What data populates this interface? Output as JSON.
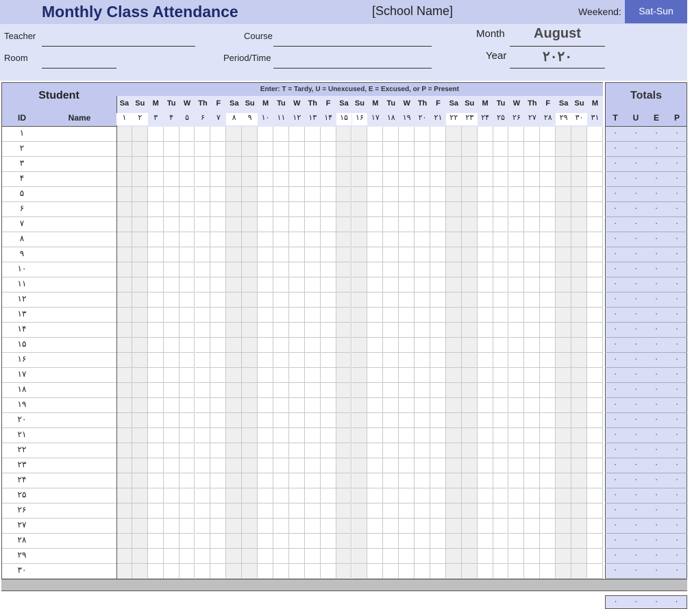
{
  "header": {
    "title": "Monthly Class Attendance",
    "school_name": "[School Name]",
    "weekend_label": "Weekend:",
    "weekend_value": "Sat-Sun"
  },
  "info": {
    "teacher_label": "Teacher",
    "room_label": "Room",
    "course_label": "Course",
    "period_label": "Period/Time",
    "month_label": "Month",
    "month_value": "August",
    "year_label": "Year",
    "year_value": "۲۰۲۰"
  },
  "table": {
    "student_header": "Student",
    "id_header": "ID",
    "name_header": "Name",
    "legend": "Enter: T = Tardy, U = Unexcused, E = Excused, or P = Present",
    "totals_header": "Totals",
    "totals_columns": [
      "T",
      "U",
      "E",
      "P"
    ],
    "day_names": [
      "Sa",
      "Su",
      "M",
      "Tu",
      "W",
      "Th",
      "F",
      "Sa",
      "Su",
      "M",
      "Tu",
      "W",
      "Th",
      "F",
      "Sa",
      "Su",
      "M",
      "Tu",
      "W",
      "Th",
      "F",
      "Sa",
      "Su",
      "M",
      "Tu",
      "W",
      "Th",
      "F",
      "Sa",
      "Su",
      "M"
    ],
    "day_numbers": [
      "۱",
      "۲",
      "۳",
      "۴",
      "۵",
      "۶",
      "۷",
      "۸",
      "۹",
      "۱۰",
      "۱۱",
      "۱۲",
      "۱۳",
      "۱۴",
      "۱۵",
      "۱۶",
      "۱۷",
      "۱۸",
      "۱۹",
      "۲۰",
      "۲۱",
      "۲۲",
      "۲۳",
      "۲۴",
      "۲۵",
      "۲۶",
      "۲۷",
      "۲۸",
      "۲۹",
      "۳۰",
      "۳۱"
    ],
    "student_ids": [
      "۱",
      "۲",
      "۳",
      "۴",
      "۵",
      "۶",
      "۷",
      "۸",
      "۹",
      "۱۰",
      "۱۱",
      "۱۲",
      "۱۳",
      "۱۴",
      "۱۵",
      "۱۶",
      "۱۷",
      "۱۸",
      "۱۹",
      "۲۰",
      "۲۱",
      "۲۲",
      "۲۳",
      "۲۴",
      "۲۵",
      "۲۶",
      "۲۷",
      "۲۸",
      "۲۹",
      "۳۰"
    ],
    "total_value": "۰"
  },
  "colors": {
    "header_blue": "#c7cdef",
    "info_bg": "#dfe3f7",
    "weekend_badge": "#5a6bc4",
    "title_color": "#1f2a6b",
    "weekend_column": "#efefef",
    "footer_gray": "#bfbfbf"
  }
}
